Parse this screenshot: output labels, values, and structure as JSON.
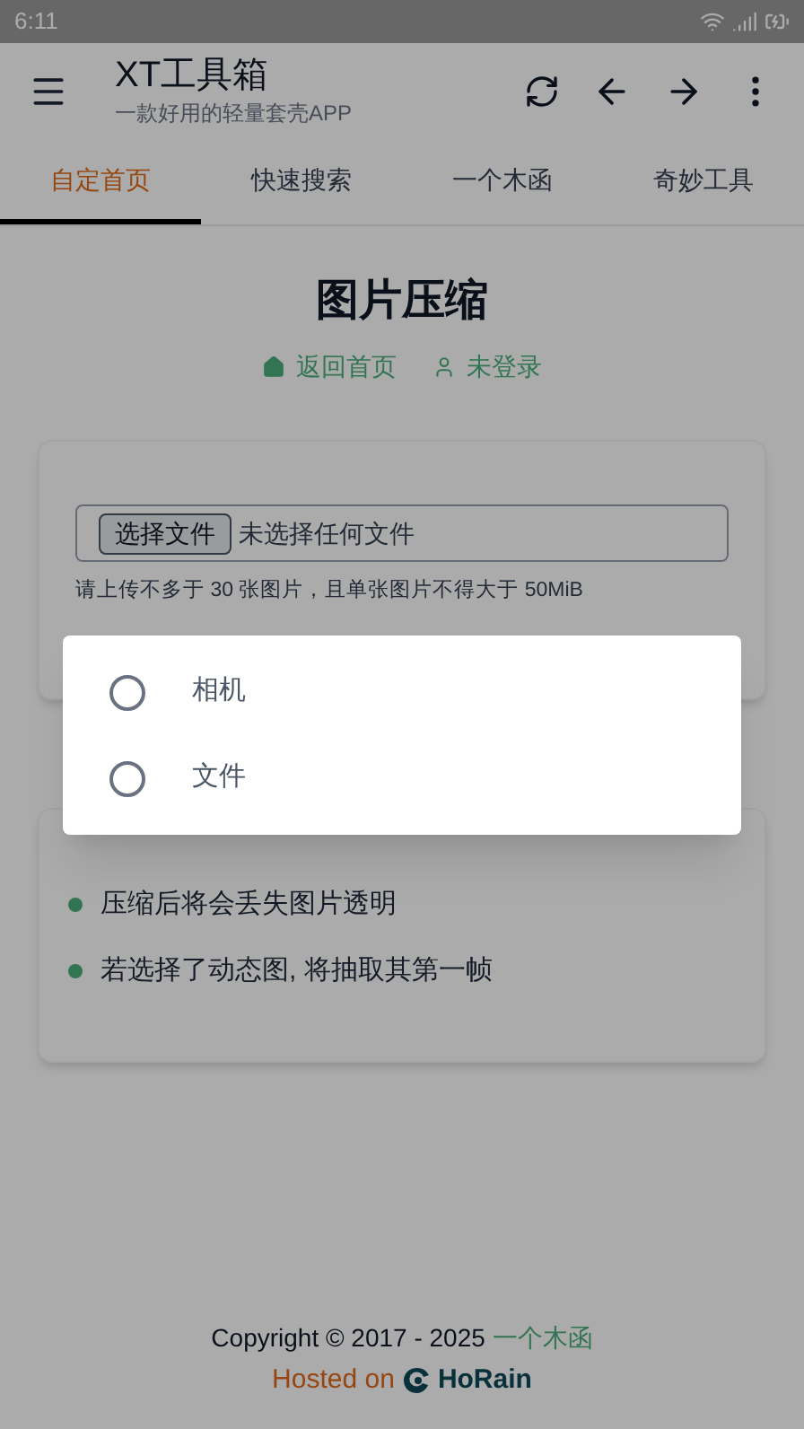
{
  "status_bar": {
    "time": "6:11"
  },
  "app_bar": {
    "title": "XT工具箱",
    "subtitle": "一款好用的轻量套壳APP"
  },
  "tabs": [
    {
      "label": "自定首页",
      "selected": true
    },
    {
      "label": "快速搜索",
      "selected": false
    },
    {
      "label": "一个木函",
      "selected": false
    },
    {
      "label": "奇妙工具",
      "selected": false
    }
  ],
  "page": {
    "title": "图片压缩",
    "links": [
      {
        "kind": "home",
        "label": "返回首页"
      },
      {
        "kind": "user",
        "label": "未登录"
      }
    ]
  },
  "upload": {
    "button": "选择文件",
    "status": "未选择任何文件",
    "hint": "请上传不多于 30 张图片，且单张图片不得大于 50MiB"
  },
  "notes": [
    "压缩后将会丢失图片透明",
    "若选择了动态图, 将抽取其第一帧"
  ],
  "dialog": {
    "options": [
      {
        "label": "相机",
        "selected": false
      },
      {
        "label": "文件",
        "selected": false
      }
    ]
  },
  "footer": {
    "copyright": "Copyright © 2017 - 2025",
    "link": "一个木函",
    "hosted": "Hosted on",
    "host_name": "HoRain"
  }
}
